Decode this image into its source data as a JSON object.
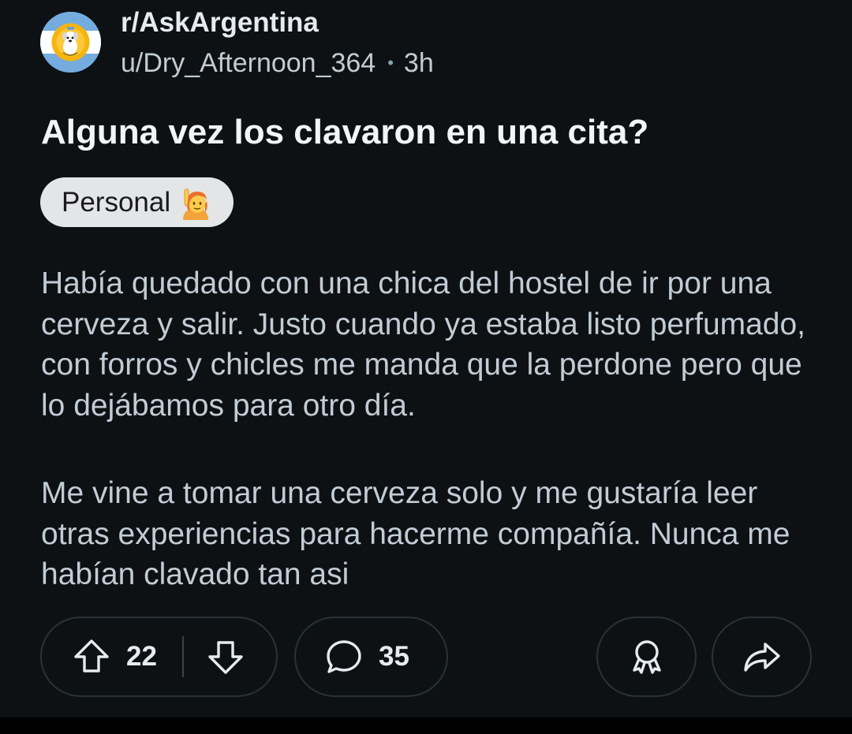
{
  "post": {
    "subreddit": "r/AskArgentina",
    "author": "u/Dry_Afternoon_364",
    "separator": "•",
    "age": "3h",
    "title": "Alguna vez los clavaron en una cita?",
    "flair": {
      "label": "Personal",
      "emoji": "person-raising-hand"
    },
    "body": [
      "Había quedado con una chica del hostel de ir por una cerveza y salir. Justo cuando ya estaba listo perfumado, con forros y chicles me manda que la perdone pero que lo dejábamos para otro día.",
      "Me vine a tomar una cerveza solo y me gustaría leer otras experiencias para hacerme compañía. Nunca me habían clavado tan asi"
    ]
  },
  "actions": {
    "upvote_icon": "arrow-up-icon",
    "score": "22",
    "downvote_icon": "arrow-down-icon",
    "comment_icon": "speech-bubble-icon",
    "comment_count": "35",
    "award_icon": "award-icon",
    "share_icon": "share-arrow-icon"
  },
  "colors": {
    "background": "#0e1113",
    "title": "#f2f4f5",
    "body_text": "#c2ccd6",
    "flair_bg": "#e3e5e7",
    "pill_border": "#2a3236",
    "avatar_flag_blue": "#74acdf",
    "avatar_sun": "#f6b40e"
  }
}
